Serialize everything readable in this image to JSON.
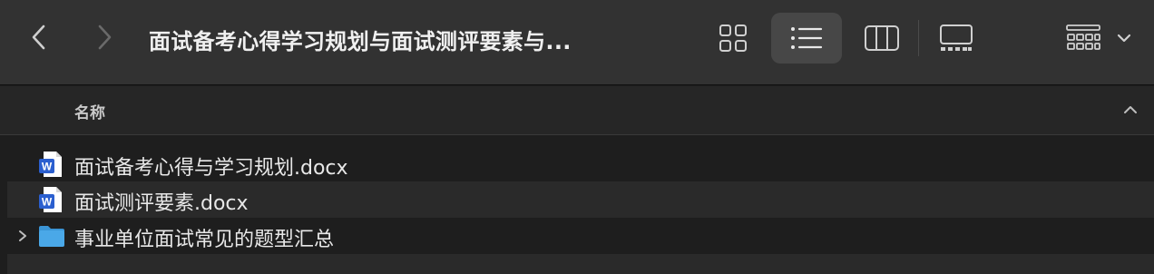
{
  "window": {
    "title": "面试备考心得学习规划与面试测评要素与..."
  },
  "toolbar": {
    "back_icon": "chevron-left-icon",
    "forward_icon": "chevron-right-icon",
    "views": [
      {
        "icon": "icon-view-icon",
        "active": false
      },
      {
        "icon": "list-view-icon",
        "active": true
      },
      {
        "icon": "column-view-icon",
        "active": false
      },
      {
        "icon": "gallery-view-icon",
        "active": false
      }
    ],
    "group_icon": "group-by-icon"
  },
  "list": {
    "column_name": "名称",
    "sort_icon": "chevron-up-icon",
    "items": [
      {
        "name": "面试备考心得与学习规划.docx",
        "type": "word-document",
        "icon": "word-doc-icon"
      },
      {
        "name": "面试测评要素.docx",
        "type": "word-document",
        "icon": "word-doc-icon"
      },
      {
        "name": "事业单位面试常见的题型汇总",
        "type": "folder",
        "icon": "folder-icon"
      }
    ]
  },
  "colors": {
    "toolbar_bg": "#323232",
    "list_bg": "#1e1e1e",
    "alt_row_bg": "#2a2a2a",
    "folder_blue": "#4aa8e8",
    "word_blue": "#2b5fcf"
  }
}
